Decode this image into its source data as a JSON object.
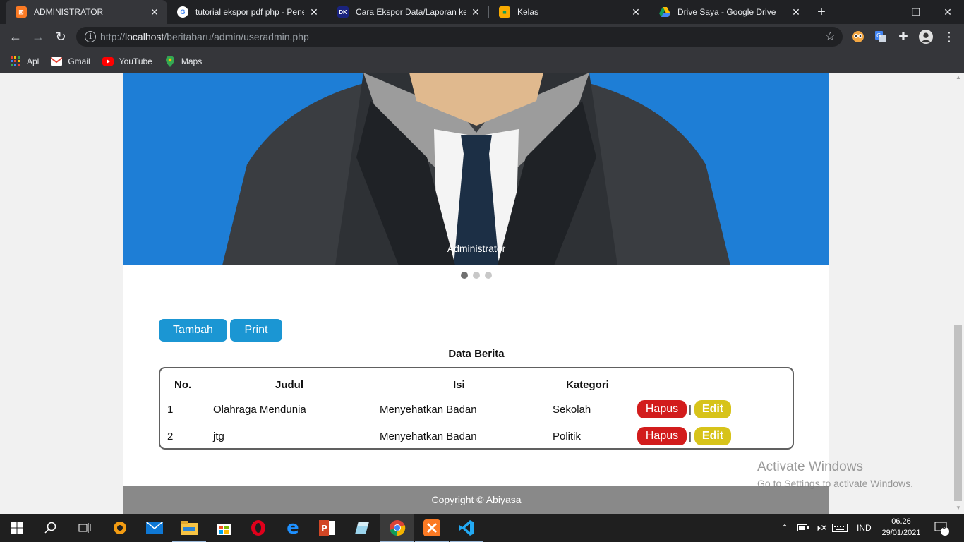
{
  "browser": {
    "tabs": [
      {
        "title": "ADMINISTRATOR",
        "favicon": "xampp-icon",
        "active": true
      },
      {
        "title": "tutorial ekspor pdf php - Penel",
        "favicon": "google-icon",
        "active": false
      },
      {
        "title": "Cara Ekspor Data/Laporan ke P",
        "favicon": "site-dk-icon",
        "active": false
      },
      {
        "title": "Kelas",
        "favicon": "classroom-icon",
        "active": false
      },
      {
        "title": "Drive Saya - Google Drive",
        "favicon": "drive-icon",
        "active": false
      }
    ],
    "url_prefix": "http://",
    "url_host": "localhost",
    "url_path": "/beritabaru/admin/useradmin.php",
    "bookmarks": [
      {
        "label": "Apl",
        "icon": "apps-grid-icon"
      },
      {
        "label": "Gmail",
        "icon": "gmail-icon"
      },
      {
        "label": "YouTube",
        "icon": "youtube-icon"
      },
      {
        "label": "Maps",
        "icon": "maps-icon"
      }
    ]
  },
  "page": {
    "carousel_caption": "Administrator",
    "carousel_slides": 3,
    "carousel_active": 1,
    "buttons": {
      "tambah": "Tambah",
      "print": "Print"
    },
    "table_title": "Data Berita",
    "columns": [
      "No.",
      "Judul",
      "Isi",
      "Kategori"
    ],
    "rows": [
      {
        "no": "1",
        "judul": "Olahraga Mendunia",
        "isi": "Menyehatkan Badan",
        "kategori": "Sekolah"
      },
      {
        "no": "2",
        "judul": "jtg",
        "isi": "Menyehatkan Badan",
        "kategori": "Politik"
      }
    ],
    "row_actions": {
      "hapus": "Hapus",
      "separator": "|",
      "edit": "Edit"
    },
    "footer": "Copyright © Abiyasa",
    "colors": {
      "hero": "#1e7ed6",
      "primary_button": "#1b96d3",
      "hapus": "#d21c1c",
      "edit": "#d7c31a",
      "footer": "#898989"
    }
  },
  "watermark": {
    "line1": "Activate Windows",
    "line2": "Go to Settings to activate Windows."
  },
  "taskbar": {
    "apps": [
      "start-icon",
      "search-icon",
      "task-view-icon",
      "settings-gear-icon",
      "mail-icon",
      "file-explorer-icon",
      "store-icon",
      "opera-icon",
      "edge-icon",
      "powerpoint-icon",
      "notes-icon",
      "chrome-icon",
      "xampp-icon",
      "vscode-icon"
    ],
    "language": "IND",
    "time": "06.26",
    "date": "29/01/2021",
    "notifications": "5"
  }
}
